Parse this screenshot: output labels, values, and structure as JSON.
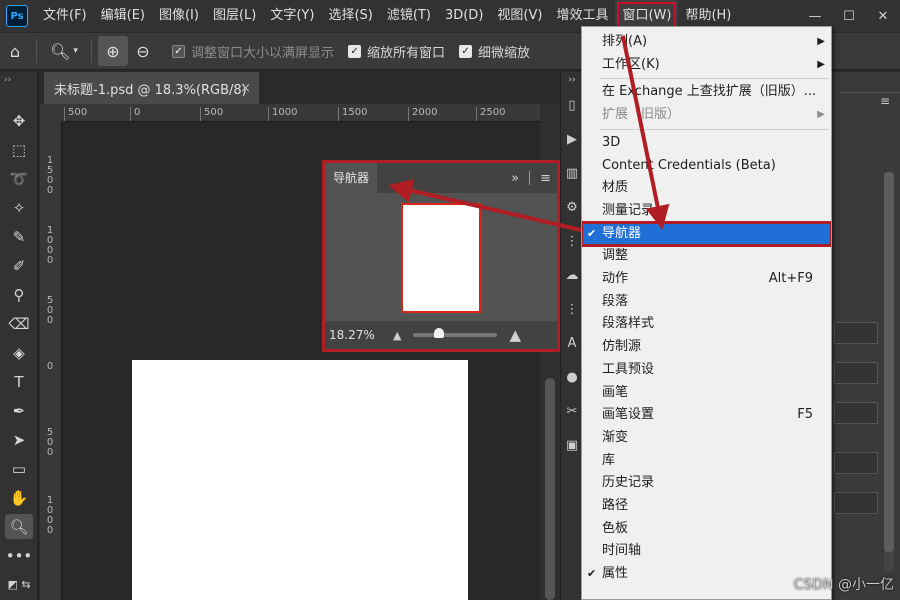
{
  "app": {
    "logo": "Ps",
    "menus": [
      "文件(F)",
      "编辑(E)",
      "图像(I)",
      "图层(L)",
      "文字(Y)",
      "选择(S)",
      "滤镜(T)",
      "3D(D)",
      "视图(V)",
      "增效工具",
      "窗口(W)",
      "帮助(H)"
    ],
    "active_menu": "窗口(W)"
  },
  "window_controls": {
    "minimize": "—",
    "maximize": "☐",
    "close": "✕"
  },
  "options_bar": {
    "fit_window": "调整窗口大小以满屏显示",
    "zoom_all": "缩放所有窗口",
    "scrubby_zoom": "细微缩放"
  },
  "document": {
    "tab_title": "未标题-1.psd @ 18.3%(RGB/8)",
    "close": "×"
  },
  "rulers": {
    "horizontal": [
      "500",
      "0",
      "500",
      "1000",
      "1500",
      "2000",
      "2500"
    ],
    "vertical": [
      "1500",
      "1000",
      "500",
      "0",
      "500",
      "1000"
    ]
  },
  "navigator": {
    "title": "导航器",
    "expand": "»",
    "menu": "≡",
    "zoom": "18.27%",
    "zoom_fraction": 0.3
  },
  "window_menu": {
    "items": [
      {
        "label": "排列(A)",
        "submenu": true
      },
      {
        "label": "工作区(K)",
        "submenu": true
      },
      {
        "sep": true
      },
      {
        "label": "在 Exchange 上查找扩展（旧版）..."
      },
      {
        "label": "扩展（旧版）",
        "submenu": true,
        "disabled": true
      },
      {
        "sep": true
      },
      {
        "label": "3D"
      },
      {
        "label": "Content Credentials (Beta)"
      },
      {
        "label": "材质"
      },
      {
        "label": "测量记录"
      },
      {
        "label": "导航器",
        "checked": true,
        "highlight": true
      },
      {
        "label": "调整"
      },
      {
        "label": "动作",
        "shortcut": "Alt+F9"
      },
      {
        "label": "段落"
      },
      {
        "label": "段落样式"
      },
      {
        "label": "仿制源"
      },
      {
        "label": "工具预设"
      },
      {
        "label": "画笔"
      },
      {
        "label": "画笔设置",
        "shortcut": "F5"
      },
      {
        "label": "渐变"
      },
      {
        "label": "库"
      },
      {
        "label": "历史记录"
      },
      {
        "label": "路径"
      },
      {
        "label": "色板"
      },
      {
        "label": "时间轴"
      },
      {
        "label": "属性",
        "checked": true
      }
    ]
  },
  "colors": {
    "annotation_red": "#b01e23",
    "highlight_blue": "#1f6fd6"
  },
  "watermark": "CSDN @小一亿"
}
